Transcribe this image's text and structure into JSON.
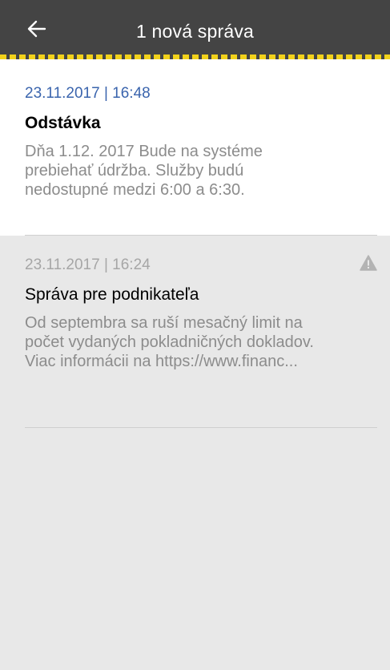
{
  "header": {
    "title": "1 nová správa",
    "back_icon": "arrow-left-icon",
    "background": "#444444",
    "stripe_color": "#f2d21b"
  },
  "messages": [
    {
      "date": "23.11.2017 | 16:48",
      "title": "Odstávka",
      "body": "Dňa 1.12. 2017 Bude na systéme prebiehať údržba. Služby budú nedostupné medzi 6:00 a 6:30.",
      "read": false,
      "date_color": "#3a64ad"
    },
    {
      "date": "23.11.2017 | 16:24",
      "title": "Správa pre podnikateľa",
      "body": "Od septembra sa ruší mesačný limit na počet vydaných pokladničných dokladov. Viac informácii na https://www.financ...",
      "read": true,
      "icon": "warning-icon",
      "date_color": "#a6a6a6"
    }
  ]
}
